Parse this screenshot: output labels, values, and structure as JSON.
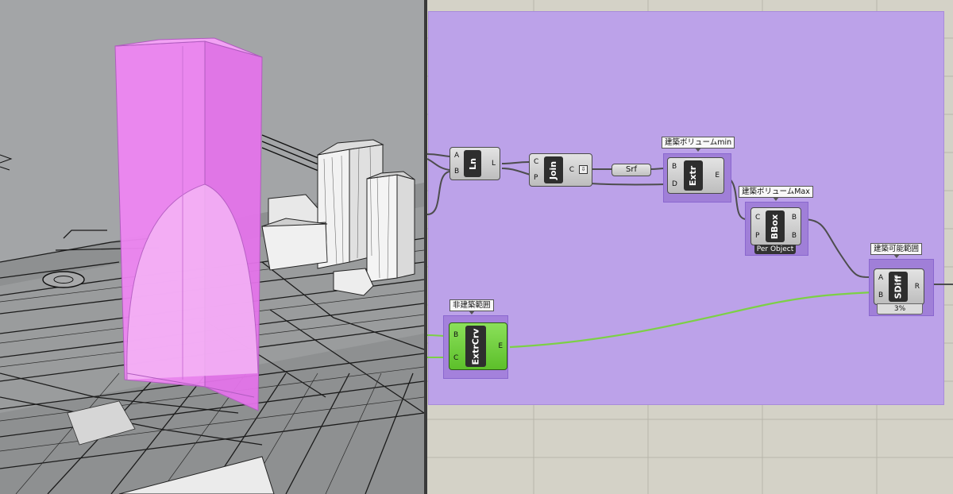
{
  "canvas": {
    "groups": {
      "min_label": "建築ボリュームmin",
      "max_label": "建築ボリュームMax",
      "range_label": "建築可能範囲",
      "nonbuild_label": "非建築範囲"
    },
    "components": {
      "line": {
        "name": "Ln",
        "inputs": [
          "A",
          "B"
        ],
        "outputs": [
          "L"
        ]
      },
      "join": {
        "name": "Join",
        "inputs": [
          "C",
          "P"
        ],
        "outputs": [
          "C"
        ]
      },
      "surface": {
        "name": "Srf"
      },
      "extrude": {
        "name": "Extr",
        "inputs": [
          "B",
          "D"
        ],
        "outputs": [
          "E"
        ]
      },
      "bbox": {
        "name": "BBox",
        "inputs": [
          "C",
          "P"
        ],
        "outputs": [
          "B",
          "B"
        ],
        "tag": "Per Object"
      },
      "sdiff": {
        "name": "SDiff",
        "inputs": [
          "A",
          "B"
        ],
        "outputs": [
          "R"
        ],
        "progress": "3%"
      },
      "extrcrv": {
        "name": "ExtrCrv",
        "inputs": [
          "B",
          "C"
        ],
        "outputs": [
          "E"
        ]
      }
    }
  },
  "colors": {
    "group_fill": "#bca2e9",
    "volume_magenta": "#ee86f2",
    "wire_green": "#7cd046",
    "canvas_bg": "#d4d2c7"
  }
}
